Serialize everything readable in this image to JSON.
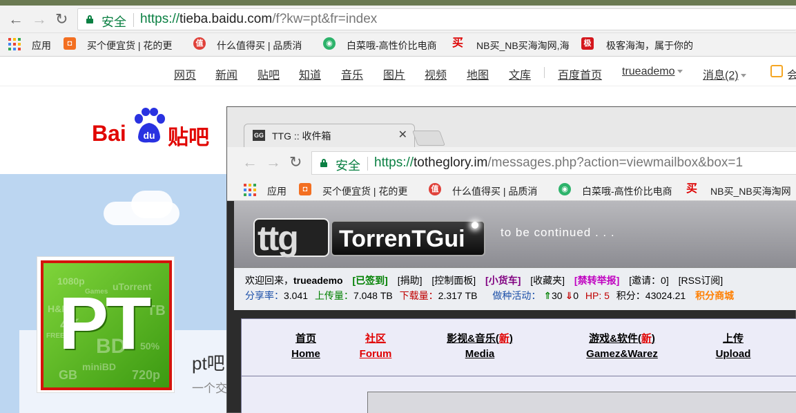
{
  "back_browser": {
    "secure_label": "安全",
    "url_scheme": "https://",
    "url_domain": "tieba.baidu.com",
    "url_path": "/f?kw=pt&fr=index",
    "bookmarks": [
      "应用",
      "买个便宜货 | 花的更",
      "什么值得买 | 品质消",
      "白菜哦-高性价比电商",
      "NB买_NB买海淘网,海",
      "极客海淘，属于你的"
    ]
  },
  "baidu_nav": {
    "links": [
      "网页",
      "新闻",
      "贴吧",
      "知道",
      "音乐",
      "图片",
      "视频",
      "地图",
      "文库"
    ],
    "home": "百度首页",
    "user": "trueademo",
    "messages": "消息(2)",
    "member": "会"
  },
  "baidu_logo": {
    "bai": "Bai",
    "du": "du",
    "tieba": "贴吧"
  },
  "forum": {
    "title": "pt吧",
    "subtitle": "一个交",
    "logo_text": "PT",
    "logo_watermarks": [
      "1080p",
      "uTorrent",
      "H&R",
      "4K",
      "BD",
      "TB",
      "50%",
      "miniBD",
      "GB",
      "720p",
      "FREE",
      "Games"
    ]
  },
  "front_window": {
    "tab_title": "TTG :: 收件箱",
    "tab_icon": "GG",
    "secure_label": "安全",
    "url_scheme": "https://",
    "url_domain": "totheglory.im",
    "url_path": "/messages.php?action=viewmailbox&box=1",
    "bookmarks": [
      "应用",
      "买个便宜货 | 花的更",
      "什么值得买 | 品质消",
      "白菜哦-高性价比电商",
      "NB买_NB买海淘网"
    ]
  },
  "ttg": {
    "logo_small": "ttg",
    "logo_name": "TorrenTGui",
    "tagline": "to be continued . . .",
    "welcome": "欢迎回来，",
    "username": "trueademo",
    "links": [
      {
        "text": "[已签到]",
        "color": "#008000"
      },
      {
        "text": "[捐助]",
        "color": "#000000"
      },
      {
        "text": "[控制面板]",
        "color": "#000000"
      },
      {
        "text": "[小货车]",
        "color": "#800080"
      },
      {
        "text": "[收藏夹]",
        "color": "#000000"
      },
      {
        "text": "[禁转举报]",
        "color": "#c000c0"
      },
      {
        "text": "[邀请：0]",
        "color": "#000000"
      },
      {
        "text": "[RSS订阅]",
        "color": "#000000"
      }
    ],
    "stats": {
      "ratio_label": "分享率：",
      "ratio": "3.041",
      "upload_label": "上传量：",
      "upload": "7.048 TB",
      "download_label": "下载量：",
      "download": "2.317 TB",
      "seeding_label": "做种活动：",
      "seeding_up": "30",
      "seeding_down": "0",
      "hp": "HP: 5",
      "points_label": "积分：",
      "points": "43024.21",
      "shop": "积分商城"
    },
    "nav": [
      {
        "cn": "首页",
        "en": "Home",
        "red": false
      },
      {
        "cn": "社区",
        "en": "Forum",
        "red": true
      },
      {
        "cn_a": "影视&音乐(",
        "cn_new": "新",
        "cn_b": ")",
        "en": "Media"
      },
      {
        "cn_a": "游戏&软件(",
        "cn_new": "新",
        "cn_b": ")",
        "en": "Gamez&Warez"
      },
      {
        "cn": "上传",
        "en": "Upload",
        "red": false
      }
    ]
  }
}
